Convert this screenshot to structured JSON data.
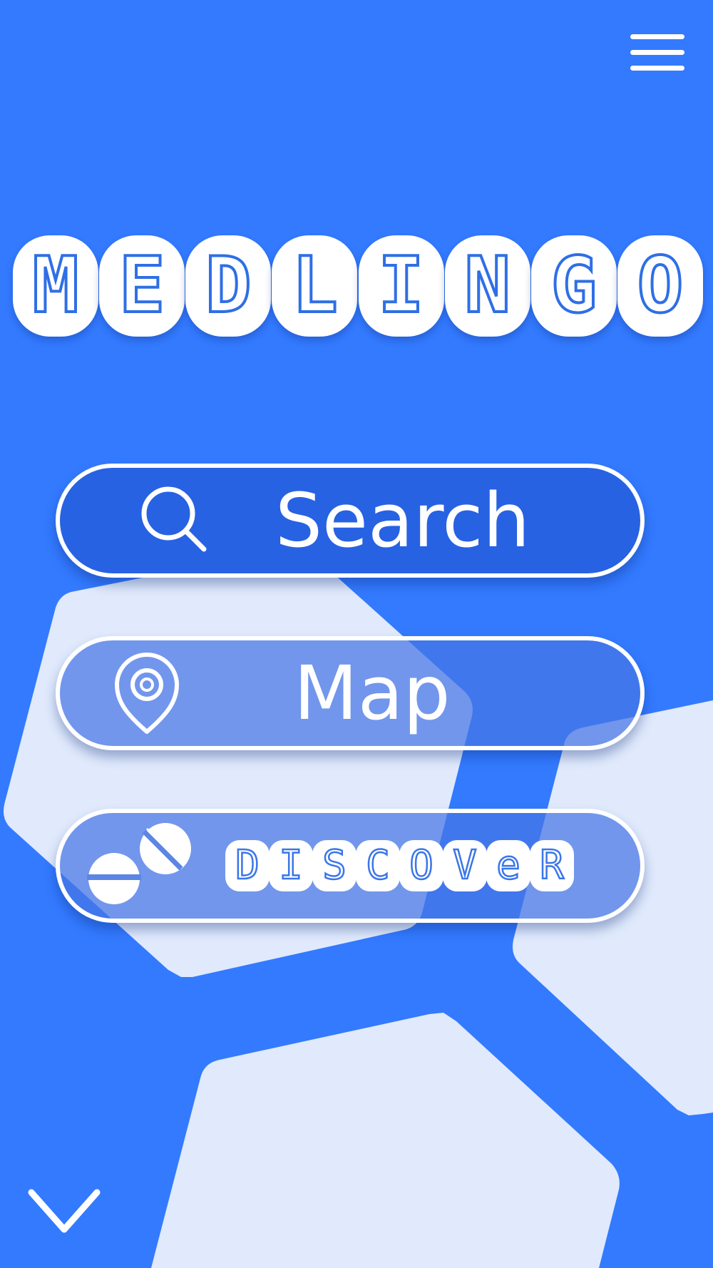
{
  "app": {
    "logo_letters": [
      "M",
      "E",
      "D",
      "L",
      "I",
      "N",
      "G",
      "O"
    ]
  },
  "header": {
    "menu_icon": "hamburger-menu-icon"
  },
  "buttons": {
    "search": {
      "label": "Search",
      "icon": "search-icon"
    },
    "map": {
      "label": "Map",
      "icon": "map-pin-icon"
    },
    "discover": {
      "letters": [
        "D",
        "I",
        "S",
        "C",
        "O",
        "V",
        "e",
        "R"
      ],
      "icon": "pills-icon"
    }
  },
  "footer": {
    "scroll_icon": "chevron-down-icon"
  },
  "colors": {
    "background": "#337aff",
    "shape_light": "#e0eafc",
    "button_dark": "#2762e3",
    "white": "#ffffff"
  }
}
